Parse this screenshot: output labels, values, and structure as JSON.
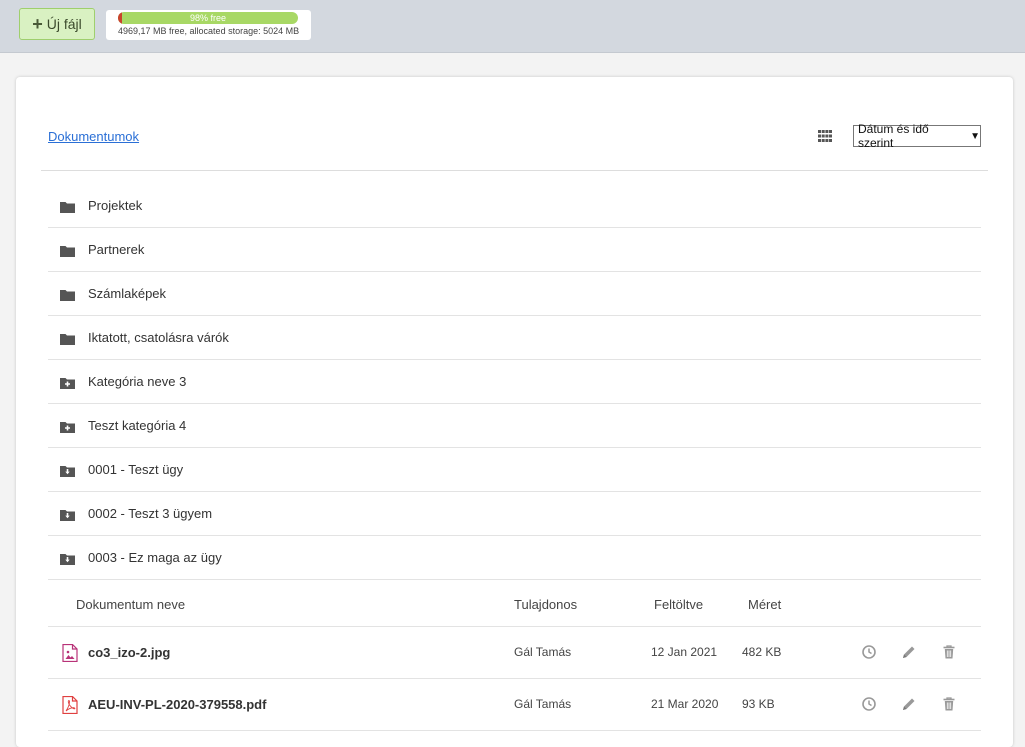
{
  "toolbar": {
    "new_file_label": "Új fájl"
  },
  "storage": {
    "bar_text": "98% free",
    "free_fraction": 0.98,
    "meta_text": "4969,17 MB free, allocated storage: 5024 MB",
    "colors": {
      "free": "#a8d865",
      "used": "#c9432c"
    }
  },
  "breadcrumb": {
    "root": "Dokumentumok"
  },
  "sort": {
    "selected": "Dátum és idő szerint"
  },
  "folders": [
    {
      "label": "Projektek",
      "icon": "folder-icon"
    },
    {
      "label": "Partnerek",
      "icon": "folder-icon"
    },
    {
      "label": "Számlaképek",
      "icon": "folder-icon"
    },
    {
      "label": "Iktatott, csatolásra várók",
      "icon": "folder-icon"
    },
    {
      "label": "Kategória neve 3",
      "icon": "folder-plus-icon"
    },
    {
      "label": "Teszt kategória 4",
      "icon": "folder-plus-icon"
    },
    {
      "label": "0001 - Teszt ügy",
      "icon": "folder-download-icon"
    },
    {
      "label": "0002 - Teszt 3 ügyem",
      "icon": "folder-download-icon"
    },
    {
      "label": "0003 - Ez maga az ügy",
      "icon": "folder-download-icon"
    }
  ],
  "table": {
    "headers": {
      "name": "Dokumentum neve",
      "owner": "Tulajdonos",
      "uploaded": "Feltöltve",
      "size": "Méret"
    },
    "rows": [
      {
        "name": "co3_izo-2.jpg",
        "owner": "Gál Tamás",
        "uploaded": "12 Jan 2021",
        "size": "482 KB",
        "icon": "image-file-icon"
      },
      {
        "name": "AEU-INV-PL-2020-379558.pdf",
        "owner": "Gál Tamás",
        "uploaded": "21 Mar 2020",
        "size": "93 KB",
        "icon": "pdf-file-icon"
      }
    ]
  }
}
